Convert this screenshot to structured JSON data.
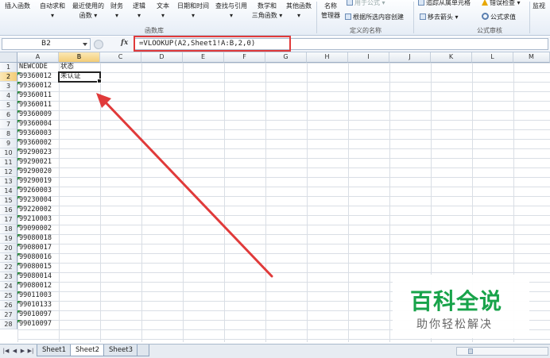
{
  "ribbon": {
    "buttons": [
      {
        "id": "insert_fn",
        "line1": "插入函数",
        "line2": ""
      },
      {
        "id": "autosum",
        "line1": "自动求和",
        "line2": "▾"
      },
      {
        "id": "recent",
        "line1": "最近使用的",
        "line2": "函数 ▾"
      },
      {
        "id": "finance",
        "line1": "财务",
        "line2": "▾"
      },
      {
        "id": "logic",
        "line1": "逻辑",
        "line2": "▾"
      },
      {
        "id": "text",
        "line1": "文本",
        "line2": "▾"
      },
      {
        "id": "datetime",
        "line1": "日期和时间",
        "line2": "▾"
      },
      {
        "id": "lookup",
        "line1": "查找与引用",
        "line2": "▾"
      },
      {
        "id": "math",
        "line1": "数学和",
        "line2": "三角函数 ▾"
      },
      {
        "id": "other",
        "line1": "其他函数",
        "line2": "▾"
      },
      {
        "id": "namemgr",
        "line1": "名称",
        "line2": "管理器"
      }
    ],
    "group_fnlib": "函数库",
    "use_in_formula": "用于公式 ▾",
    "create_from_sel": "根据所选内容创建",
    "group_names": "定义的名称",
    "trace_dep": "追踪从属单元格",
    "error_check": "错误检查 ▾",
    "remove_arrows": "移去箭头 ▾",
    "eval_formula": "公式求值",
    "group_audit": "公式审核",
    "watch": "监视"
  },
  "formula_bar": {
    "name_box": "B2",
    "fx": "fx",
    "formula": "=VLOOKUP(A2,Sheet1!A:B,2,0)"
  },
  "grid": {
    "columns": [
      "A",
      "B",
      "C",
      "D",
      "E",
      "F",
      "G",
      "H",
      "I",
      "J",
      "K",
      "L",
      "M"
    ],
    "selected_column": "B",
    "selected_row": "2",
    "active_cell": "B2",
    "rows": [
      {
        "n": "1",
        "a": "NEWCODE",
        "b": "状态"
      },
      {
        "n": "2",
        "a": "99360012",
        "b": "未认证"
      },
      {
        "n": "3",
        "a": "99360012",
        "b": ""
      },
      {
        "n": "4",
        "a": "99360011",
        "b": ""
      },
      {
        "n": "5",
        "a": "99360011",
        "b": ""
      },
      {
        "n": "6",
        "a": "99360009",
        "b": ""
      },
      {
        "n": "7",
        "a": "99360004",
        "b": ""
      },
      {
        "n": "8",
        "a": "99360003",
        "b": ""
      },
      {
        "n": "9",
        "a": "99360002",
        "b": ""
      },
      {
        "n": "10",
        "a": "99290023",
        "b": ""
      },
      {
        "n": "11",
        "a": "99290021",
        "b": ""
      },
      {
        "n": "12",
        "a": "99290020",
        "b": ""
      },
      {
        "n": "13",
        "a": "99290019",
        "b": ""
      },
      {
        "n": "14",
        "a": "99260003",
        "b": ""
      },
      {
        "n": "15",
        "a": "99230004",
        "b": ""
      },
      {
        "n": "16",
        "a": "99220002",
        "b": ""
      },
      {
        "n": "17",
        "a": "99210003",
        "b": ""
      },
      {
        "n": "18",
        "a": "99090002",
        "b": ""
      },
      {
        "n": "19",
        "a": "99080018",
        "b": ""
      },
      {
        "n": "20",
        "a": "99080017",
        "b": ""
      },
      {
        "n": "21",
        "a": "99080016",
        "b": ""
      },
      {
        "n": "22",
        "a": "99080015",
        "b": ""
      },
      {
        "n": "23",
        "a": "99080014",
        "b": ""
      },
      {
        "n": "24",
        "a": "99080012",
        "b": ""
      },
      {
        "n": "25",
        "a": "99011003",
        "b": ""
      },
      {
        "n": "26",
        "a": "99010133",
        "b": ""
      },
      {
        "n": "27",
        "a": "99010097",
        "b": ""
      },
      {
        "n": "28",
        "a": "99010097",
        "b": ""
      }
    ]
  },
  "sheets": [
    {
      "label": "Sheet1",
      "active": false
    },
    {
      "label": "Sheet2",
      "active": true
    },
    {
      "label": "Sheet3",
      "active": false
    }
  ],
  "watermark": {
    "logo": "百科全说",
    "tagline": "助你轻松解决"
  },
  "colors": {
    "highlight_red": "#e03a3a",
    "watermark_green": "#18a34a",
    "selected_header": "#f3cd77"
  }
}
